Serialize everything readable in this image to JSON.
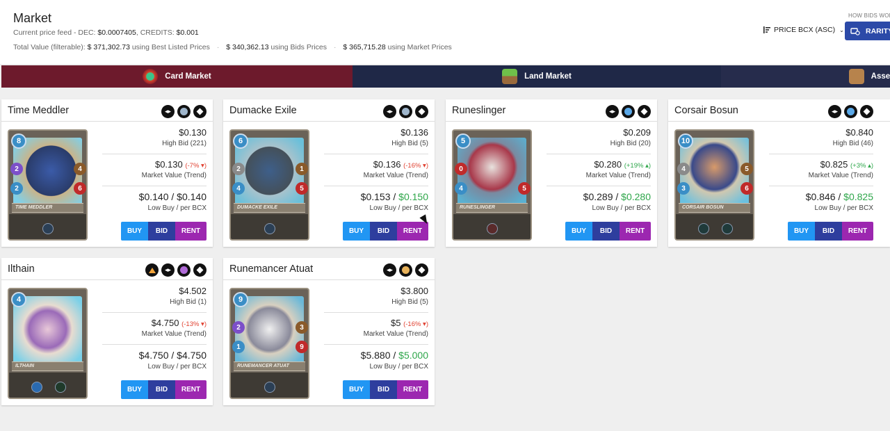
{
  "header": {
    "title": "Market",
    "feed_label": "Current price feed - DEC:",
    "feed_dec": "$0.0007405",
    "feed_credits_label": ", CREDITS:",
    "feed_credits": "$0.001",
    "totals_label": "Total Value (filterable):",
    "total_listed": "$ 371,302.73",
    "total_listed_label": "using Best Listed Prices",
    "total_bids": "$ 340,362.13",
    "total_bids_label": "using Bids Prices",
    "total_market": "$ 365,715.28",
    "total_market_label": "using Market Prices",
    "how_bids": "HOW BIDS WOR",
    "sort_label": "PRICE BCX (ASC)",
    "rarity_label": "RARITY"
  },
  "tabs": {
    "card": "Card Market",
    "land": "Land Market",
    "asset": "Asset"
  },
  "cards": [
    {
      "name": "Time Meddler",
      "banner": "Time Meddler",
      "mana": "8",
      "price": "$0.130",
      "high_bid": "High Bid (221)",
      "market": "$0.130",
      "trend": "(-7% ▾)",
      "low_buy": "$0.140 / ",
      "per_bcx": "$0.140",
      "market_label": "Market Value (Trend)",
      "low_label": "Low Buy / per BCX",
      "buy": "BUY",
      "bid": "BID",
      "rent": "RENT"
    },
    {
      "name": "Dumacke Exile",
      "banner": "Dumacke Exile",
      "mana": "6",
      "price": "$0.136",
      "high_bid": "High Bid (5)",
      "market": "$0.136",
      "trend": "(-16% ▾)",
      "low_buy": "$0.153 / ",
      "per_bcx": "$0.150",
      "market_label": "Market Value (Trend)",
      "low_label": "Low Buy / per BCX",
      "buy": "BUY",
      "bid": "BID",
      "rent": "RENT"
    },
    {
      "name": "Runeslinger",
      "banner": "Runeslinger",
      "mana": "5",
      "price": "$0.209",
      "high_bid": "High Bid (20)",
      "market": "$0.280",
      "trend": "(+19% ▴)",
      "low_buy": "$0.289 / ",
      "per_bcx": "$0.280",
      "market_label": "Market Value (Trend)",
      "low_label": "Low Buy / per BCX",
      "buy": "BUY",
      "bid": "BID",
      "rent": "RENT"
    },
    {
      "name": "Corsair Bosun",
      "banner": "Corsair Bosun",
      "mana": "10",
      "price": "$0.840",
      "high_bid": "High Bid (46)",
      "market": "$0.825",
      "trend": "(+3% ▴)",
      "low_buy": "$0.846 / ",
      "per_bcx": "$0.825",
      "market_label": "Market Value (Trend)",
      "low_label": "Low Buy / per BCX",
      "buy": "BUY",
      "bid": "BID",
      "rent": "RENT"
    },
    {
      "name": "Ilthain",
      "banner": "Ilthain",
      "mana": "4",
      "price": "$4.502",
      "high_bid": "High Bid (1)",
      "market": "$4.750",
      "trend": "(-13% ▾)",
      "low_buy": "$4.750 / ",
      "per_bcx": "$4.750",
      "market_label": "Market Value (Trend)",
      "low_label": "Low Buy / per BCX",
      "buy": "BUY",
      "bid": "BID",
      "rent": "RENT"
    },
    {
      "name": "Runemancer Atuat",
      "banner": "Runemancer Atuat",
      "mana": "9",
      "price": "$3.800",
      "high_bid": "High Bid (5)",
      "market": "$5",
      "trend": "(-16% ▾)",
      "low_buy": "$5.880 / ",
      "per_bcx": "$5.000",
      "market_label": "Market Value (Trend)",
      "low_label": "Low Buy / per BCX",
      "buy": "BUY",
      "bid": "BID",
      "rent": "RENT"
    }
  ],
  "colors": {
    "card_tab": "#6d1a2c",
    "land_tab": "#1f2847",
    "buy": "#2196f3",
    "bid": "#2e3e9e",
    "rent": "#9c27b0",
    "positive": "#2ea64a",
    "negative": "#e04030"
  }
}
